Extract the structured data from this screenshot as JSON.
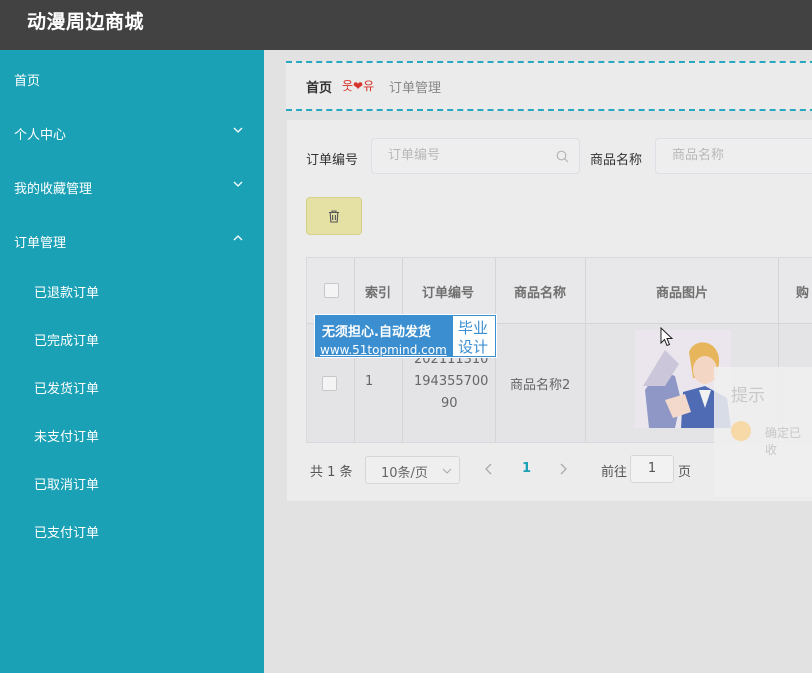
{
  "app": {
    "title": "动漫周边商城"
  },
  "sidebar": {
    "items": [
      {
        "label": "首页",
        "has_chevron": false
      },
      {
        "label": "个人中心",
        "has_chevron": true,
        "chevron": "chevron-down-icon"
      },
      {
        "label": "我的收藏管理",
        "has_chevron": true,
        "chevron": "chevron-down-icon"
      },
      {
        "label": "订单管理",
        "has_chevron": true,
        "chevron": "chevron-up-icon",
        "expanded": true
      }
    ],
    "sub_items": [
      {
        "label": "已退款订单"
      },
      {
        "label": "已完成订单"
      },
      {
        "label": "已发货订单"
      },
      {
        "label": "未支付订单"
      },
      {
        "label": "已取消订单"
      },
      {
        "label": "已支付订单"
      }
    ]
  },
  "breadcrumb": {
    "home": "首页",
    "separator": "웃❤유",
    "current": "订单管理"
  },
  "search": {
    "order_no_label": "订单编号",
    "order_no_placeholder": "订单编号",
    "product_name_label": "商品名称",
    "product_name_placeholder": "商品名称"
  },
  "toolbar": {
    "delete_icon": "trash-icon"
  },
  "table": {
    "headers": [
      "索引",
      "订单编号",
      "商品名称",
      "商品图片",
      "购"
    ],
    "rows": [
      {
        "index": "1",
        "order_no_lines": [
          "202111310",
          "194355700",
          "90"
        ],
        "product_name": "商品名称2"
      }
    ]
  },
  "pagination": {
    "total": "共 1 条",
    "page_size": "10条/页",
    "current_page": "1",
    "goto_label": "前往",
    "goto_value": "1",
    "page_suffix": "页"
  },
  "watermark": {
    "line1": "无须担心.自动发货",
    "line2": "www.51topmind.com",
    "box_line1": "毕业",
    "box_line2": "设计"
  },
  "dialog": {
    "title": "提示",
    "message": "确定已收"
  },
  "colors": {
    "sidebar": "#1aa1b6",
    "topbar": "#424242",
    "accent": "#26a7c2",
    "pager_active": "#1aa1b6"
  }
}
